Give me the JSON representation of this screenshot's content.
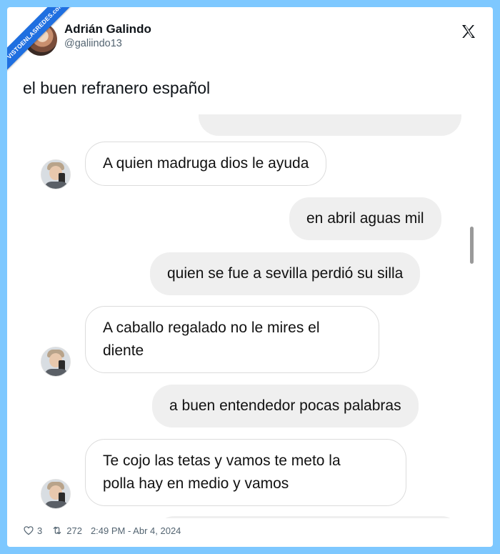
{
  "watermark": "VISTOENLASREDES.com",
  "author": {
    "name": "Adrián Galindo",
    "handle": "@galiindo13"
  },
  "tweet": {
    "text": "el buen refranero español"
  },
  "chat": {
    "messages": [
      {
        "from": "them",
        "lines": [
          "A quien madruga dios le ayuda"
        ]
      },
      {
        "from": "me",
        "lines": [
          "en abril aguas mil"
        ]
      },
      {
        "from": "me",
        "lines": [
          "quien se fue a sevilla perdió su silla"
        ]
      },
      {
        "from": "them",
        "lines": [
          "A caballo regalado no le mires el",
          "diente"
        ]
      },
      {
        "from": "me",
        "lines": [
          "a buen entendedor pocas palabras"
        ]
      },
      {
        "from": "them",
        "lines": [
          "Te cojo las tetas y vamos te meto la",
          "polla hay en medio y vamos"
        ]
      }
    ]
  },
  "footer": {
    "likes": "3",
    "retweets": "272",
    "timestamp": "2:49 PM - Abr 4, 2024"
  },
  "icons": {
    "close": "x-logo",
    "like": "heart-icon",
    "retweet": "retweet-icon"
  }
}
